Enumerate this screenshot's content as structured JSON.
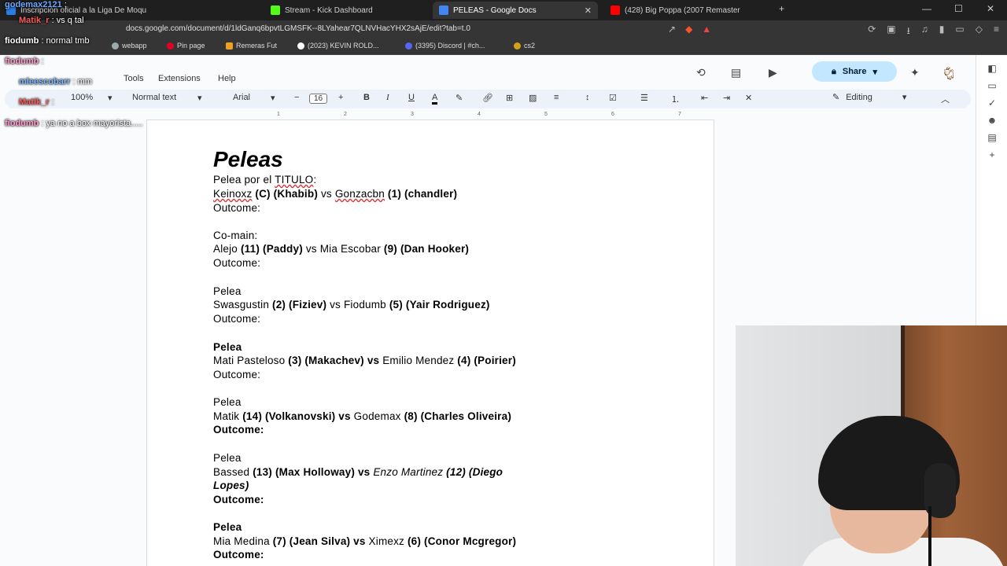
{
  "browser": {
    "tabs": [
      {
        "label": "Inscripción oficial a la Liga De Moqu",
        "favcolor": "#2a7de1"
      },
      {
        "label": "Stream - Kick Dashboard",
        "favcolor": "#53fc18"
      },
      {
        "label": "PELEAS - Google Docs",
        "favcolor": "#4285f4",
        "active": true
      },
      {
        "label": "(428) Big Poppa (2007 Remaster",
        "favcolor": "#ff0000"
      }
    ],
    "url": "docs.google.com/document/d/1ldGanq6bpvtLGMSFK--8LYahear7QLNVHacYHX2sAjE/edit?tab=t.0",
    "bookmarks": [
      "webapp",
      "Pin page",
      "Remeras Fut",
      "(2023) KEVIN ROLD...",
      "(3395) Discord | #ch...",
      "cs2"
    ]
  },
  "docs": {
    "menus": [
      "Tools",
      "Extensions",
      "Help"
    ],
    "share_label": "Share",
    "toolbar": {
      "zoom": "100%",
      "style": "Normal text",
      "font": "Arial",
      "font_size": "16",
      "mode": "Editing"
    },
    "ruler": [
      "1",
      "2",
      "3",
      "4",
      "5",
      "6",
      "7"
    ]
  },
  "document": {
    "title": "Peleas",
    "lines": [
      {
        "segments": [
          {
            "t": "Pelea por el "
          },
          {
            "t": "TITULO",
            "u": true
          },
          {
            "t": ":"
          }
        ]
      },
      {
        "segments": [
          {
            "t": "Keinoxz",
            "u": true
          },
          {
            "t": " (C) (Khabib) ",
            "b": true
          },
          {
            "t": "vs "
          },
          {
            "t": "Gonzacbn",
            "u": true
          },
          {
            "t": " (1) (chandler)",
            "b": true
          }
        ]
      },
      {
        "segments": [
          {
            "t": "Outcome:"
          }
        ]
      },
      {
        "segments": [
          {
            "t": "Co-main:"
          }
        ]
      },
      {
        "segments": [
          {
            "t": "Alejo "
          },
          {
            "t": "(11) (Paddy) ",
            "b": true
          },
          {
            "t": "vs Mia Escobar "
          },
          {
            "t": "(9) (Dan Hooker)",
            "b": true
          }
        ]
      },
      {
        "segments": [
          {
            "t": "Outcome:"
          }
        ]
      },
      {
        "segments": [
          {
            "t": "Pelea"
          }
        ]
      },
      {
        "segments": [
          {
            "t": "Swasgustin "
          },
          {
            "t": "(2) (Fiziev) ",
            "b": true
          },
          {
            "t": "vs Fiodumb "
          },
          {
            "t": "(5) (Yair Rodriguez)",
            "b": true
          }
        ]
      },
      {
        "segments": [
          {
            "t": "Outcome:"
          }
        ]
      },
      {
        "segments": [
          {
            "t": "Pelea",
            "b": true
          }
        ]
      },
      {
        "segments": [
          {
            "t": "Mati Pasteloso "
          },
          {
            "t": "(3) (Makachev) vs ",
            "b": true
          },
          {
            "t": "Emilio Mendez "
          },
          {
            "t": "(4) (Poirier)",
            "b": true
          }
        ]
      },
      {
        "segments": [
          {
            "t": "Outcome:"
          }
        ]
      },
      {
        "segments": [
          {
            "t": "Pelea"
          }
        ]
      },
      {
        "segments": [
          {
            "t": "Matik "
          },
          {
            "t": "(14) (Volkanovski) vs ",
            "b": true
          },
          {
            "t": "Godemax "
          },
          {
            "t": "(8) (Charles Oliveira)",
            "b": true
          }
        ]
      },
      {
        "segments": [
          {
            "t": "Outcome:",
            "b": true
          }
        ]
      },
      {
        "segments": [
          {
            "t": "Pelea"
          }
        ]
      },
      {
        "segments": [
          {
            "t": "Bassed "
          },
          {
            "t": "(13) (Max Holloway) vs ",
            "b": true
          },
          {
            "t": "Enzo Martinez ",
            "i": true
          },
          {
            "t": "(12) (Diego",
            "b": true,
            "i": true
          }
        ]
      },
      {
        "segments": [
          {
            "t": "Lopes)",
            "b": true,
            "i": true
          }
        ]
      },
      {
        "segments": [
          {
            "t": "Outcome:",
            "b": true
          }
        ]
      },
      {
        "segments": [
          {
            "t": "Pelea",
            "b": true
          }
        ]
      },
      {
        "segments": [
          {
            "t": "Mia Medina "
          },
          {
            "t": "(7) (Jean Silva) vs ",
            "b": true
          },
          {
            "t": "Ximexz "
          },
          {
            "t": "(6) (Conor Mcgregor)",
            "b": true
          }
        ]
      },
      {
        "segments": [
          {
            "t": "Outcome:",
            "b": true
          }
        ]
      }
    ]
  },
  "chat": [
    {
      "user": "godemax2121",
      "msg": ":",
      "color": "#6fa8ff"
    },
    {
      "user": "Matik_r",
      "msg": ": vs q tal",
      "color": "#ff5b5b"
    },
    {
      "user": "fiodumb",
      "msg": ": normal tmb",
      "color": "#ffffff"
    },
    {
      "user": "fiodumb",
      "msg": ":",
      "color": "#ff9acb"
    },
    {
      "user": "mleescobarr",
      "msg": ": mm",
      "color": "#7fb7ff"
    },
    {
      "user": "Matik_r",
      "msg": ":",
      "color": "#ff5b5b"
    },
    {
      "user": "fiodumb",
      "msg": ": ya no a box mayorista.....",
      "color": "#ff9acb"
    }
  ]
}
